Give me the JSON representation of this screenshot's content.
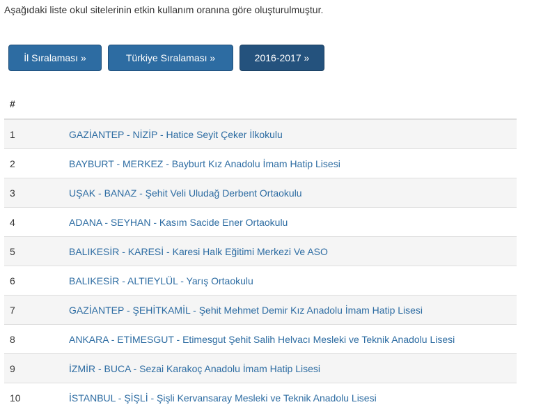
{
  "intro_text": "Aşağıdaki liste okul sitelerinin etkin kullanım oranına göre oluşturulmuştur.",
  "buttons": {
    "il": "İl Sıralaması »",
    "turkiye": "Türkiye Sıralaması »",
    "year": "2016-2017 »"
  },
  "table": {
    "header_rank": "#",
    "rows": [
      {
        "rank": "1",
        "school": "GAZİANTEP - NİZİP - Hatice Seyit Çeker İlkokulu"
      },
      {
        "rank": "2",
        "school": "BAYBURT - MERKEZ - Bayburt Kız Anadolu İmam Hatip Lisesi"
      },
      {
        "rank": "3",
        "school": "UŞAK - BANAZ - Şehit Veli Uludağ Derbent Ortaokulu"
      },
      {
        "rank": "4",
        "school": "ADANA - SEYHAN - Kasım Sacide Ener Ortaokulu"
      },
      {
        "rank": "5",
        "school": "BALIKESİR - KARESİ - Karesi Halk Eğitimi Merkezi Ve ASO"
      },
      {
        "rank": "6",
        "school": "BALIKESİR - ALTIEYLÜL - Yarış Ortaokulu"
      },
      {
        "rank": "7",
        "school": "GAZİANTEP - ŞEHİTKAMİL - Şehit Mehmet Demir Kız Anadolu İmam Hatip Lisesi"
      },
      {
        "rank": "8",
        "school": "ANKARA - ETİMESGUT - Etimesgut Şehit Salih Helvacı Mesleki ve Teknik Anadolu Lisesi"
      },
      {
        "rank": "9",
        "school": "İZMİR - BUCA - Sezai Karakoç Anadolu İmam Hatip Lisesi"
      },
      {
        "rank": "10",
        "school": "İSTANBUL - ŞİŞLİ - Şişli Kervansaray Mesleki ve Teknik Anadolu Lisesi"
      }
    ]
  },
  "colors": {
    "button_primary": "#2d6ca2",
    "button_active": "#24527d",
    "link": "#2d6ca2",
    "stripe": "#f5f5f5"
  }
}
